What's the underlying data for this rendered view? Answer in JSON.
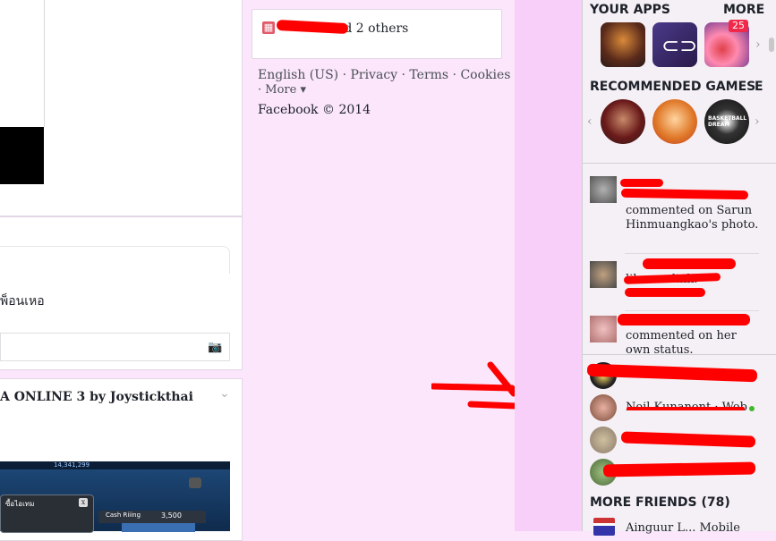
{
  "feed": {
    "thai_text": "พ็อนเหอ",
    "post_title": "A ONLINE 3 by Joystickthai",
    "camera_icon": "camera-icon",
    "game_dialog_title": "ซื้อไอเทม",
    "game_close": "x",
    "game_row_label": "Cash Riiing",
    "game_row_value": "3,500",
    "game_top_text": "14,341,299"
  },
  "center": {
    "sponsor_text": "and 2 others",
    "footer_line1": "English (US) · Privacy · Terms · Cookies",
    "footer_line2": "· More ▾",
    "copyright": "Facebook © 2014"
  },
  "right": {
    "your_apps": "YOUR APPS",
    "more": "MORE",
    "app_badge": "25",
    "app2_glyph": "⊂⊃",
    "recommended_games": "RECOMMENDED GAMES",
    "recommended_clip": "E",
    "game3_label": "BASKETBALL DREAM",
    "ticker": [
      {
        "text": "commented on Sarun Hinmuangkao's photo."
      },
      {
        "text": "likes … link."
      },
      {
        "text": "commented on her own status."
      }
    ],
    "friends": [
      {
        "name": ""
      },
      {
        "name": "Neil Kunanont · Web"
      },
      {
        "name": ""
      },
      {
        "name": ""
      }
    ],
    "more_friends": "MORE FRIENDS (78)",
    "more_friend_name": "Ainguur L... Mobile"
  },
  "colors": {
    "page_bg": "#fbe6fb",
    "stripe": "#f8cff8",
    "scribble": "#ff0000",
    "online_dot": "#42b72a"
  }
}
